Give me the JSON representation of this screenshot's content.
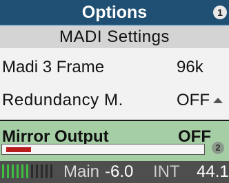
{
  "header": {
    "title": "Options"
  },
  "section": {
    "title": "MADI Settings"
  },
  "rows": [
    {
      "label": "Madi 3 Frame",
      "value": "96k"
    },
    {
      "label": "Redundancy M.",
      "value": "OFF"
    }
  ],
  "active_row": {
    "label": "Mirror Output",
    "value": "OFF",
    "progress": 0.13
  },
  "status": {
    "channel": "Main",
    "level": "-6.0",
    "clock": "INT",
    "rate": "44.1"
  },
  "meter": {
    "lit_segments": 6,
    "total_segments": 11
  },
  "colors": {
    "title_bg": "#1f4f73",
    "active_bg": "#a5cea5",
    "progress_fill": "#b81c1c",
    "meter_on": "#3fbf3f",
    "meter_off": "#2a2a2a"
  },
  "icons": {
    "encoder_1": "encoder-1-icon",
    "encoder_2": "encoder-2-icon",
    "scroll": "scroll-up-icon"
  },
  "badges": {
    "encoder_1": "1",
    "encoder_2": "2"
  }
}
